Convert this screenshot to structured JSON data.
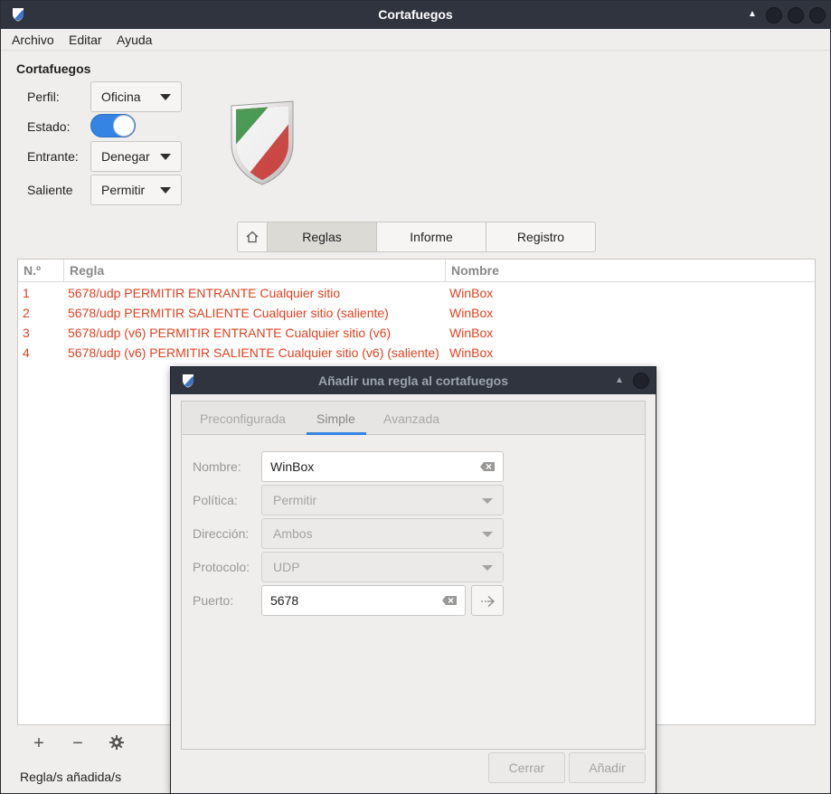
{
  "window": {
    "title": "Cortafuegos"
  },
  "menubar": {
    "items": [
      "Archivo",
      "Editar",
      "Ayuda"
    ]
  },
  "firewall": {
    "section_title": "Cortafuegos",
    "profile_label": "Perfil:",
    "profile_value": "Oficina",
    "status_label": "Estado:",
    "status_on": true,
    "incoming_label": "Entrante:",
    "incoming_value": "Denegar",
    "outgoing_label": "Saliente",
    "outgoing_value": "Permitir"
  },
  "tabs": {
    "home_icon": "home-icon",
    "items": [
      "Reglas",
      "Informe",
      "Registro"
    ],
    "active": "Reglas"
  },
  "rules_table": {
    "columns": [
      "N.º",
      "Regla",
      "Nombre"
    ],
    "rows": [
      {
        "num": "1",
        "rule": "5678/udp PERMITIR ENTRANTE Cualquier sitio",
        "name": "WinBox"
      },
      {
        "num": "2",
        "rule": "5678/udp PERMITIR SALIENTE Cualquier sitio (saliente)",
        "name": "WinBox"
      },
      {
        "num": "3",
        "rule": "5678/udp (v6) PERMITIR ENTRANTE Cualquier sitio (v6)",
        "name": "WinBox"
      },
      {
        "num": "4",
        "rule": "5678/udp (v6) PERMITIR SALIENTE Cualquier sitio (v6) (saliente)",
        "name": "WinBox"
      }
    ],
    "row_color": "#e0421f"
  },
  "bottombar": {
    "add": "+",
    "remove": "−",
    "settings_icon": "gear-icon"
  },
  "statusbar": {
    "text": "Regla/s añadida/s"
  },
  "dialog": {
    "title": "Añadir una regla al cortafuegos",
    "tabs": [
      "Preconfigurada",
      "Simple",
      "Avanzada"
    ],
    "active_tab": "Simple",
    "name_label": "Nombre:",
    "name_value": "WinBox",
    "policy_label": "Política:",
    "policy_value": "Permitir",
    "direction_label": "Dirección:",
    "direction_value": "Ambos",
    "protocol_label": "Protocolo:",
    "protocol_value": "UDP",
    "port_label": "Puerto:",
    "port_value": "5678",
    "close_button": "Cerrar",
    "add_button": "Añadir"
  },
  "colors": {
    "titlebar": "#2f343f",
    "accent": "#3584e4"
  }
}
